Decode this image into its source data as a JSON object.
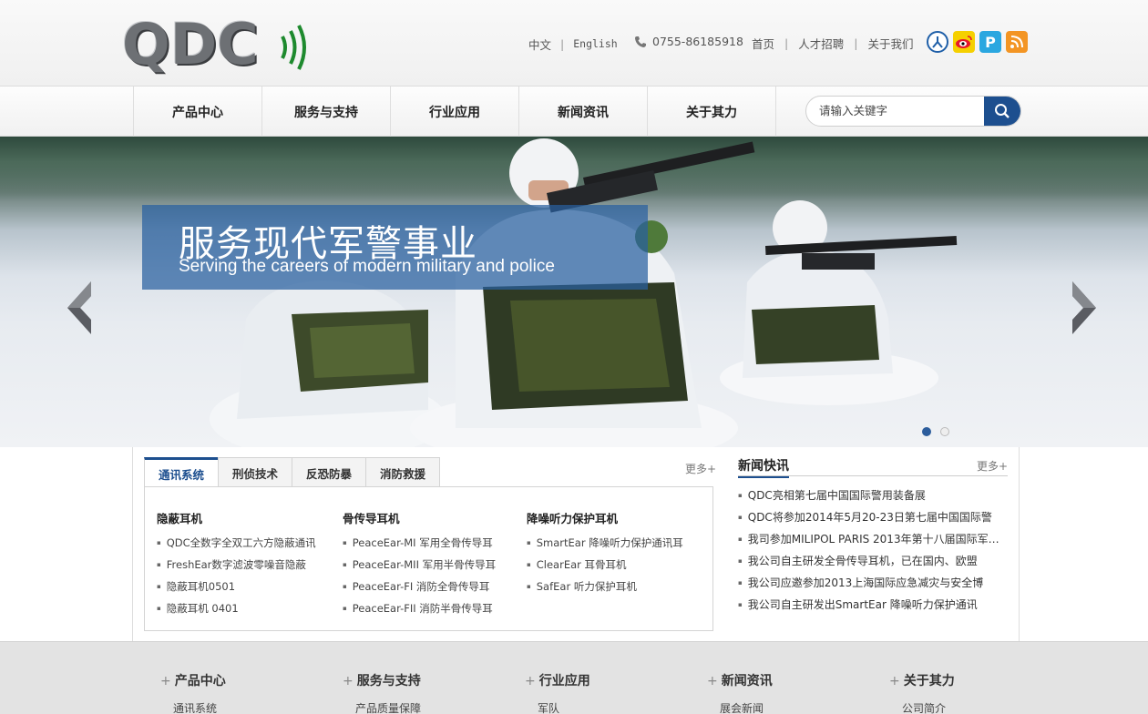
{
  "header": {
    "logo_text": "QDC",
    "lang_cn": "中文",
    "lang_en": "English",
    "phone": "0755-86185918",
    "links": [
      "首页",
      "人才招聘",
      "关于我们"
    ],
    "social": [
      "renren-icon",
      "weibo-icon",
      "pinyin-icon",
      "rss-icon"
    ]
  },
  "nav": {
    "items": [
      "产品中心",
      "服务与支持",
      "行业应用",
      "新闻资讯",
      "关于其力"
    ],
    "search_placeholder": "请输入关键字"
  },
  "banner": {
    "title_cn": "服务现代军警事业",
    "title_en": "Serving the careers of modern military and police",
    "slide_count": 2,
    "active_slide": 1
  },
  "products": {
    "tabs": [
      "通讯系统",
      "刑侦技术",
      "反恐防暴",
      "消防救援"
    ],
    "active_tab": 0,
    "more": "更多+",
    "columns": [
      {
        "title": "隐蔽耳机",
        "items": [
          "QDC全数字全双工六方隐蔽通讯",
          "FreshEar数字滤波零噪音隐蔽",
          "隐蔽耳机0501",
          "隐蔽耳机 0401"
        ]
      },
      {
        "title": "骨传导耳机",
        "items": [
          "PeaceEar-MI 军用全骨传导耳",
          "PeaceEar-MII 军用半骨传导耳",
          "PeaceEar-FI 消防全骨传导耳",
          "PeaceEar-FII 消防半骨传导耳"
        ]
      },
      {
        "title": "降噪听力保护耳机",
        "items": [
          "SmartEar 降噪听力保护通讯耳",
          "ClearEar 耳骨耳机",
          "SafEar 听力保护耳机"
        ]
      }
    ]
  },
  "news": {
    "title": "新闻快讯",
    "more": "更多+",
    "items": [
      "QDC亮相第七届中国国际警用装备展",
      "QDC将参加2014年5月20-23日第七届中国国际警",
      "我司参加MILIPOL PARIS 2013年第十八届国际军…",
      "我公司自主研发全骨传导耳机，已在国内、欧盟",
      "我公司应邀参加2013上海国际应急减灾与安全博",
      "我公司自主研发出SmartEar 降噪听力保护通讯"
    ]
  },
  "footer": {
    "columns": [
      {
        "title": "产品中心",
        "first": "通讯系统"
      },
      {
        "title": "服务与支持",
        "first": "产品质量保障"
      },
      {
        "title": "行业应用",
        "first": "军队"
      },
      {
        "title": "新闻资讯",
        "first": "展会新闻"
      },
      {
        "title": "关于其力",
        "first": "公司简介"
      }
    ]
  },
  "colors": {
    "brand_blue": "#1d4f8f",
    "logo_green": "#1e8a2e"
  }
}
